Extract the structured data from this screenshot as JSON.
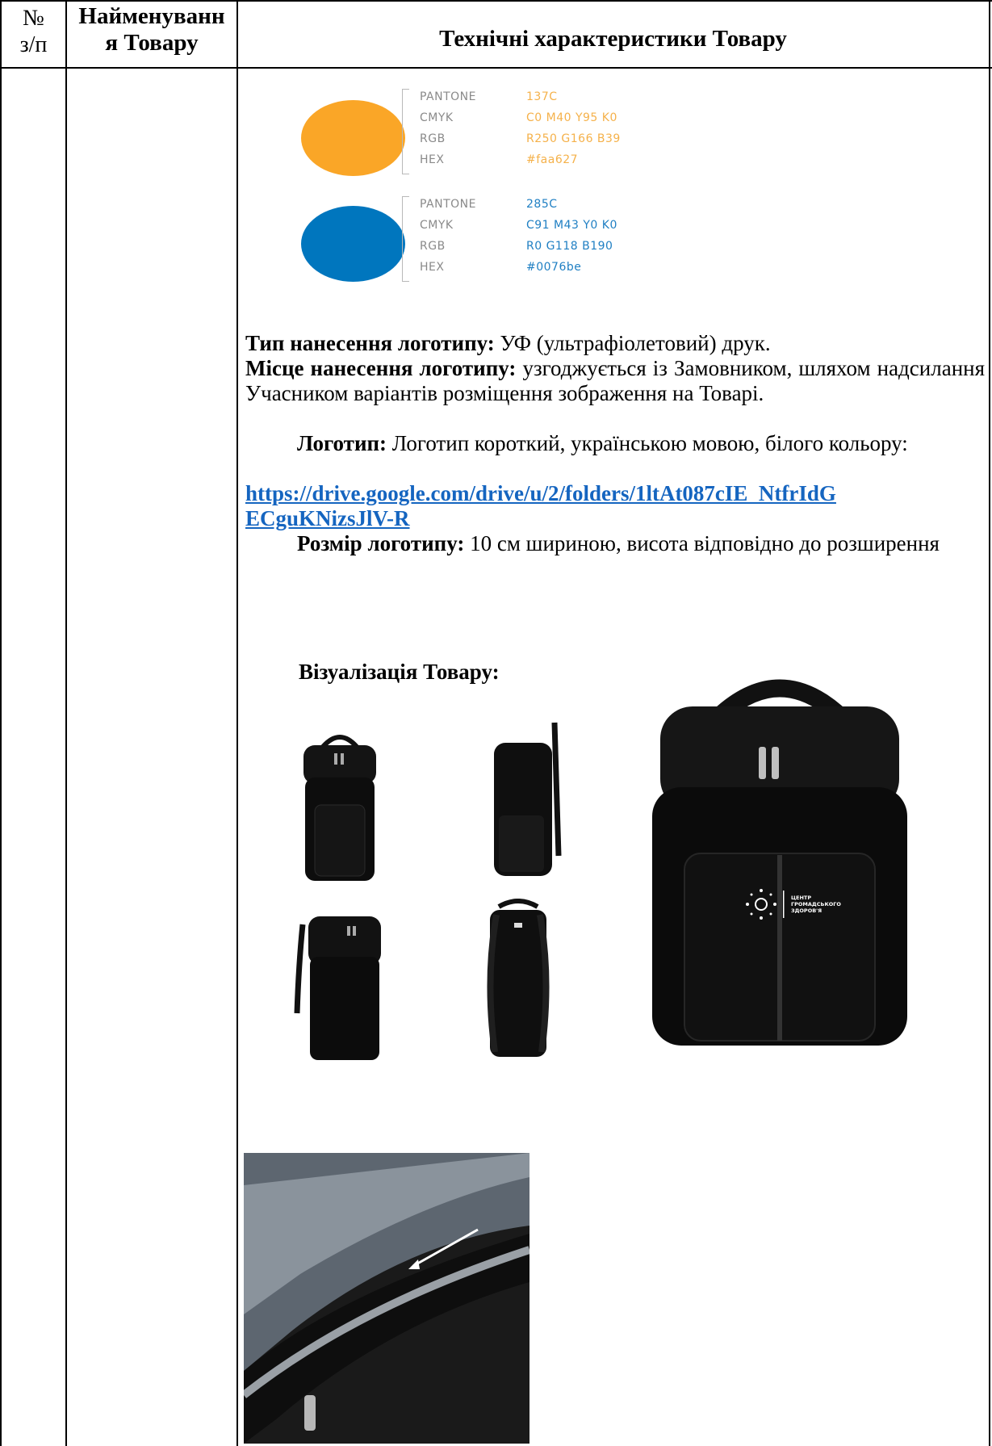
{
  "header": {
    "num_line1": "№",
    "num_line2": "з/п",
    "name_line1": "Найменуванн",
    "name_line2": "я Товару",
    "spec": "Технічні характеристики Товару"
  },
  "swatches": [
    {
      "color": "#faa627",
      "rows": [
        {
          "key": "PANTONE",
          "value": "137C"
        },
        {
          "key": "CMYK",
          "value": "C0  M40  Y95  K0"
        },
        {
          "key": "RGB",
          "value": "R250  G166  B39"
        },
        {
          "key": "HEX",
          "value": "#faa627"
        }
      ]
    },
    {
      "color": "#0076be",
      "rows": [
        {
          "key": "PANTONE",
          "value": "285C"
        },
        {
          "key": "CMYK",
          "value": "C91  M43  Y0  K0"
        },
        {
          "key": "RGB",
          "value": "R0  G118  B190"
        },
        {
          "key": "HEX",
          "value": "#0076be"
        }
      ]
    }
  ],
  "spec": {
    "print_type_label": "Тип нанесення логотипу:",
    "print_type_value": "УФ (ультрафіолетовий) друк.",
    "place_label": "Місце нанесення логотипу:",
    "place_value": "узгоджується із Замовником, шляхом надсилання Учасником варіантів розміщення зображення на Товарі.",
    "logo_label": "Логотип:",
    "logo_value": "Логотип короткий, українською мовою, білого кольору:",
    "logo_link_line1": "https://drive.google.com/drive/u/2/folders/1ltAt087cIE_NtfrIdG",
    "logo_link_line2": "ECguKNizsJlV-R",
    "size_label": "Розмір логотипу:",
    "size_value": "10 см шириною, висота відповідно до розширення",
    "visual_title": "Візуалізація Товару:"
  },
  "logo_on_bag": "ЦЕНТР ГРОМАДСЬКОГО ЗДОРОВ'Я"
}
